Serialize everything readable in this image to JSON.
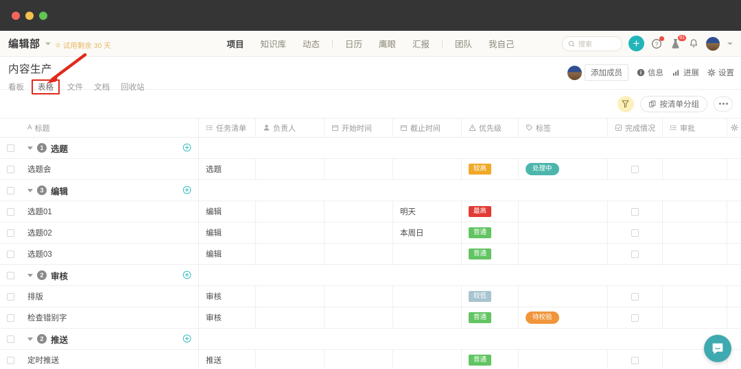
{
  "window": {
    "traffic_lights": [
      "close",
      "minimize",
      "zoom"
    ]
  },
  "global_nav": {
    "org_name": "编辑部",
    "trial_text": "试用剩余 30 天",
    "menu": [
      {
        "label": "项目",
        "active": true
      },
      {
        "label": "知识库",
        "active": false
      },
      {
        "label": "动态",
        "active": false
      },
      {
        "label": "日历",
        "active": false
      },
      {
        "label": "鹰眼",
        "active": false
      },
      {
        "label": "汇报",
        "active": false
      },
      {
        "label": "团队",
        "active": false
      },
      {
        "label": "我自己",
        "active": false
      }
    ],
    "search_placeholder": "搜索",
    "add_label": "+",
    "help_badge": "",
    "lab_badge": "91"
  },
  "project_header": {
    "title": "内容生产",
    "tabs": [
      {
        "label": "看板",
        "active": false,
        "highlighted": false
      },
      {
        "label": "表格",
        "active": true,
        "highlighted": true
      },
      {
        "label": "文件",
        "active": false,
        "highlighted": false
      },
      {
        "label": "文档",
        "active": false,
        "highlighted": false
      },
      {
        "label": "回收站",
        "active": false,
        "highlighted": false
      }
    ],
    "add_member_label": "添加成员",
    "actions": [
      {
        "label": "信息",
        "icon": "info-icon"
      },
      {
        "label": "进展",
        "icon": "chart-icon"
      },
      {
        "label": "设置",
        "icon": "gear-icon"
      }
    ]
  },
  "toolbar": {
    "filter_icon": "filter-icon",
    "group_label": "按清单分组",
    "more_label": "···"
  },
  "table": {
    "columns": [
      {
        "key": "check",
        "label": "",
        "icon": ""
      },
      {
        "key": "title",
        "label": "标题",
        "icon": "A"
      },
      {
        "key": "list",
        "label": "任务清单",
        "icon": "list-icon"
      },
      {
        "key": "owner",
        "label": "负责人",
        "icon": "person-icon"
      },
      {
        "key": "start",
        "label": "开始时间",
        "icon": "calendar-icon"
      },
      {
        "key": "due",
        "label": "截止时间",
        "icon": "calendar-icon"
      },
      {
        "key": "prio",
        "label": "优先级",
        "icon": "warning-icon"
      },
      {
        "key": "tag",
        "label": "标签",
        "icon": "tag-icon"
      },
      {
        "key": "done",
        "label": "完成情况",
        "icon": "checkbox-icon"
      },
      {
        "key": "appr",
        "label": "审批",
        "icon": "list-icon"
      },
      {
        "key": "gear",
        "label": "",
        "icon": "gear-icon"
      }
    ],
    "rows": [
      {
        "type": "group",
        "count": "1",
        "name": "选题"
      },
      {
        "type": "task",
        "title": "选题会",
        "list": "选题",
        "owner": "",
        "start": "",
        "due": "",
        "prio": {
          "text": "较高",
          "color": "#f0a92a"
        },
        "tag": {
          "text": "处理中",
          "color": "#4db6ac"
        }
      },
      {
        "type": "group",
        "count": "3",
        "name": "编辑"
      },
      {
        "type": "task",
        "title": "选题01",
        "list": "编辑",
        "owner": "",
        "start": "",
        "due": "明天",
        "prio": {
          "text": "最高",
          "color": "#e23b34"
        },
        "tag": null
      },
      {
        "type": "task",
        "title": "选题02",
        "list": "编辑",
        "owner": "",
        "start": "",
        "due": "本周日",
        "prio": {
          "text": "普通",
          "color": "#62c462"
        },
        "tag": null
      },
      {
        "type": "task",
        "title": "选题03",
        "list": "编辑",
        "owner": "",
        "start": "",
        "due": "",
        "prio": {
          "text": "普通",
          "color": "#62c462"
        },
        "tag": null
      },
      {
        "type": "group",
        "count": "2",
        "name": "审核"
      },
      {
        "type": "task",
        "title": "排版",
        "list": "审核",
        "owner": "",
        "start": "",
        "due": "",
        "prio": {
          "text": "较低",
          "color": "#a8c4cf"
        },
        "tag": null
      },
      {
        "type": "task",
        "title": "检查错别字",
        "list": "审核",
        "owner": "",
        "start": "",
        "due": "",
        "prio": {
          "text": "普通",
          "color": "#62c462"
        },
        "tag": {
          "text": "待校验",
          "color": "#f0953a"
        }
      },
      {
        "type": "group",
        "count": "2",
        "name": "推送"
      },
      {
        "type": "task",
        "title": "定时推送",
        "list": "推送",
        "owner": "",
        "start": "",
        "due": "",
        "prio": {
          "text": "普通",
          "color": "#62c462"
        },
        "tag": null
      }
    ]
  },
  "annotation": {
    "arrow_color": "#e02a1c",
    "box_color": "#e02a1c"
  },
  "chat": {
    "icon": "chat-bubble-icon",
    "color": "#3fa9b0"
  },
  "colors": {
    "accent": "#22b5ba",
    "trial": "#e8b862",
    "annotation": "#e02a1c"
  }
}
